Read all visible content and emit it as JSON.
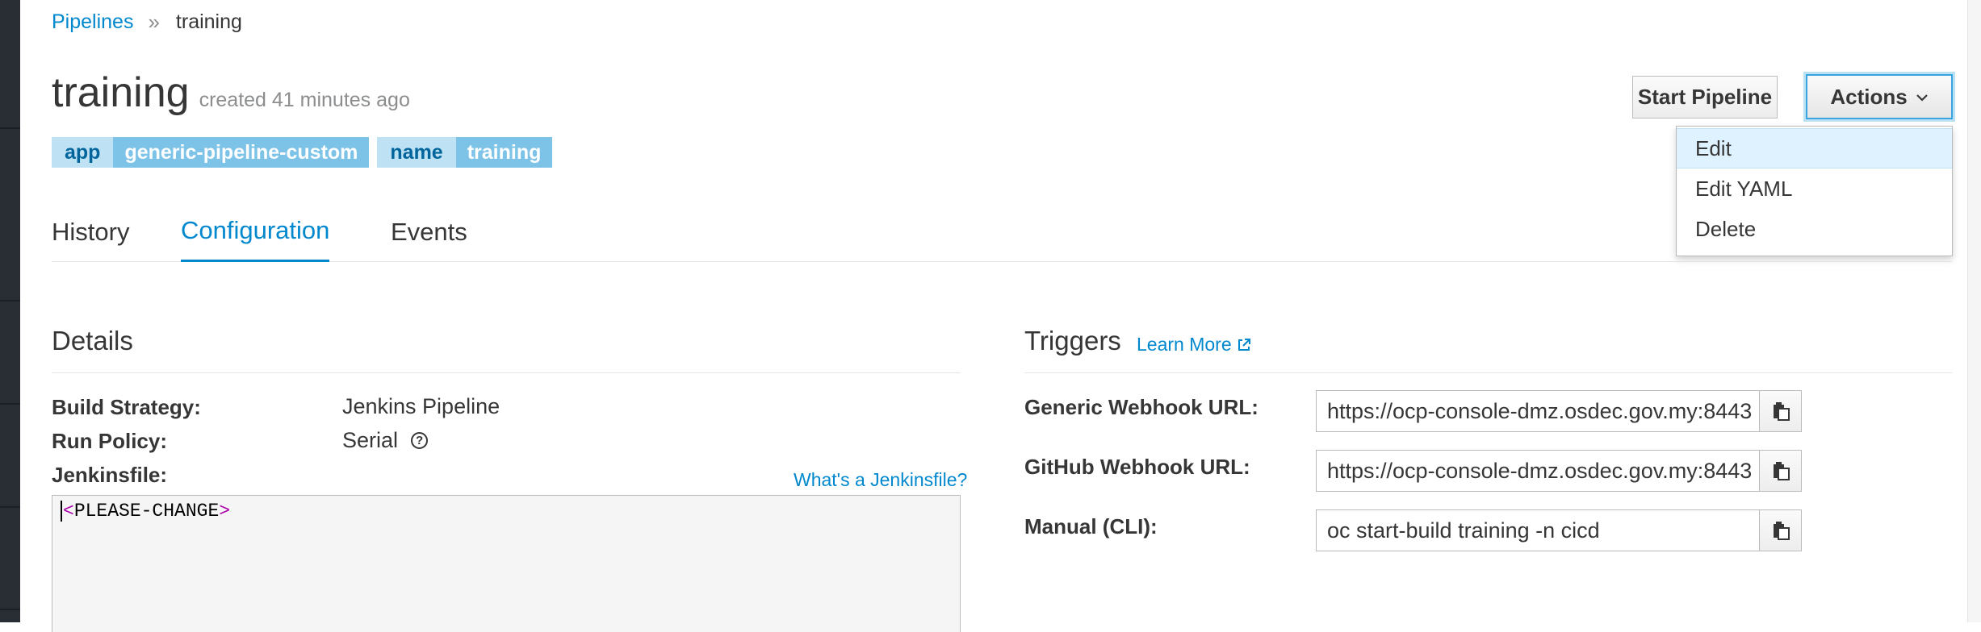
{
  "breadcrumb": {
    "parent": "Pipelines",
    "separator": "»",
    "current": "training"
  },
  "header": {
    "title": "training",
    "created": "created 41 minutes ago"
  },
  "labels": [
    {
      "key": "app",
      "value": "generic-pipeline-custom"
    },
    {
      "key": "name",
      "value": "training"
    }
  ],
  "toolbar": {
    "start_label": "Start Pipeline",
    "actions_label": "Actions"
  },
  "actions_menu": {
    "items": [
      "Edit",
      "Edit YAML",
      "Delete"
    ],
    "highlighted": "Edit"
  },
  "tabs": [
    {
      "label": "History"
    },
    {
      "label": "Configuration",
      "active": true
    },
    {
      "label": "Events"
    }
  ],
  "details": {
    "title": "Details",
    "build_strategy_label": "Build Strategy:",
    "build_strategy_value": "Jenkins Pipeline",
    "run_policy_label": "Run Policy:",
    "run_policy_value": "Serial",
    "jenkinsfile_label": "Jenkinsfile:",
    "jenkinsfile_help": "What's a Jenkinsfile?",
    "jenkinsfile_content": "PLEASE-CHANGE"
  },
  "triggers": {
    "title": "Triggers",
    "learn_more": "Learn More",
    "generic_label": "Generic Webhook URL:",
    "generic_value": "https://ocp-console-dmz.osdec.gov.my:8443",
    "github_label": "GitHub Webhook URL:",
    "github_value": "https://ocp-console-dmz.osdec.gov.my:8443",
    "manual_label": "Manual (CLI):",
    "manual_value": "oc start-build training -n cicd"
  },
  "colors": {
    "link": "#0088ce",
    "label_key_bg": "#bee1f4",
    "label_value_bg": "#7dc3e8",
    "focus": "#39a5dc"
  }
}
